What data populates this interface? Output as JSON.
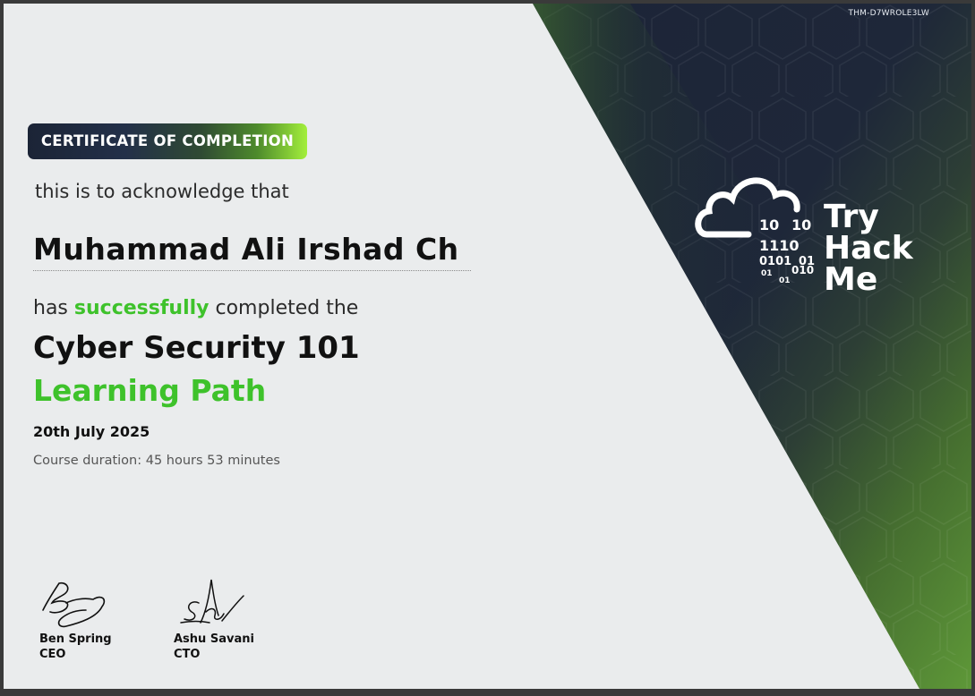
{
  "certificate_id": "THM-D7WROLE3LW",
  "badge_label": "CERTIFICATE OF COMPLETION",
  "acknowledge_text": "this is to acknowledge that",
  "recipient_name": "Muhammad Ali Irshad Ch",
  "completion_prefix": "has",
  "completion_highlight": "successfully",
  "completion_suffix": "completed the",
  "course_title": "Cyber Security 101",
  "course_subtitle": "Learning Path",
  "date": "20th July 2025",
  "duration": "Course duration: 45 hours 53 minutes",
  "signatories": [
    {
      "name": "Ben Spring",
      "title": "CEO"
    },
    {
      "name": "Ashu Savani",
      "title": "CTO"
    }
  ],
  "logo": {
    "lines": [
      "Try",
      "Hack",
      "Me"
    ],
    "binary": [
      "10",
      "10",
      "1110",
      "0101",
      "01",
      "01",
      "01",
      "010"
    ]
  },
  "colors": {
    "accent_green": "#3ec22b",
    "panel_dark": "#1c2437",
    "panel_green": "#5a8f34",
    "background": "#eaeced"
  }
}
